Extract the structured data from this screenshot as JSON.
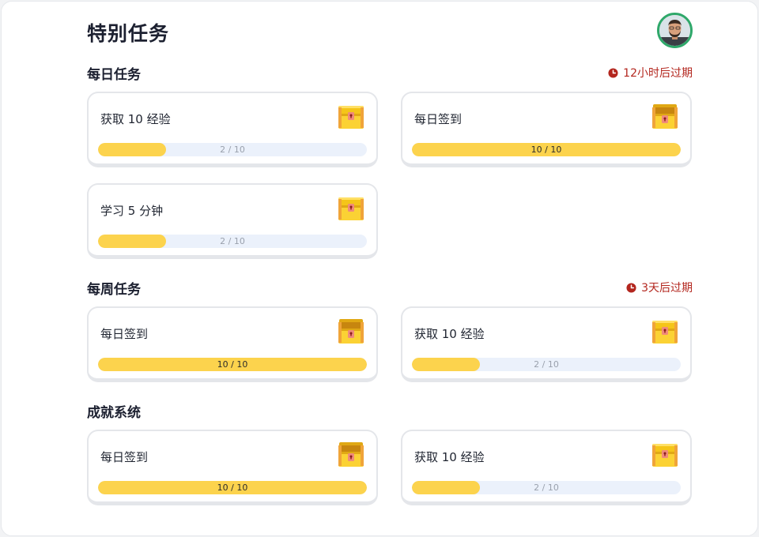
{
  "page": {
    "title": "特别任务"
  },
  "user": {
    "avatar_icon": "user-avatar"
  },
  "colors": {
    "accent": "#fcd34d",
    "track": "#ebf1fb",
    "expiry": "#b3261e",
    "avatar_ring": "#2fa86a"
  },
  "sections": [
    {
      "title": "每日任务",
      "expiry": "12小时后过期",
      "tasks": [
        {
          "label": "获取 10 经验",
          "progress_text": "2 / 10",
          "progress": 0.2,
          "chest": "closed-chest-icon"
        },
        {
          "label": "每日签到",
          "progress_text": "10 / 10",
          "progress": 1.0,
          "chest": "open-chest-icon"
        },
        {
          "label": "学习 5 分钟",
          "progress_text": "2 / 10",
          "progress": 0.2,
          "chest": "closed-chest-icon"
        }
      ]
    },
    {
      "title": "每周任务",
      "expiry": "3天后过期",
      "tasks": [
        {
          "label": "每日签到",
          "progress_text": "10 / 10",
          "progress": 1.0,
          "chest": "open-chest-icon"
        },
        {
          "label": "获取 10 经验",
          "progress_text": "2 / 10",
          "progress": 0.2,
          "chest": "closed-chest-icon"
        }
      ]
    },
    {
      "title": "成就系统",
      "expiry": "",
      "tasks": [
        {
          "label": "每日签到",
          "progress_text": "10 / 10",
          "progress": 1.0,
          "chest": "open-chest-icon"
        },
        {
          "label": "获取 10 经验",
          "progress_text": "2 / 10",
          "progress": 0.2,
          "chest": "closed-chest-icon"
        }
      ]
    }
  ]
}
